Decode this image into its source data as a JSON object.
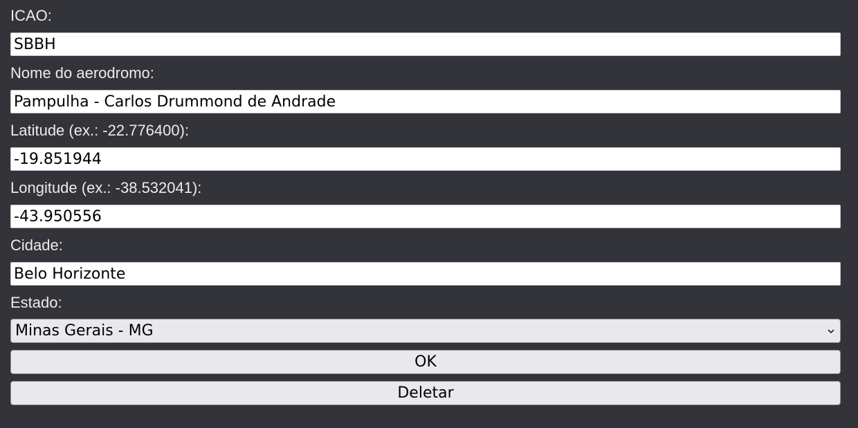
{
  "form": {
    "icao": {
      "label": "ICAO:",
      "value": "SBBH"
    },
    "nome": {
      "label": "Nome do aerodromo:",
      "value": "Pampulha - Carlos Drummond de Andrade"
    },
    "latitude": {
      "label": "Latitude (ex.: -22.776400):",
      "value": "-19.851944"
    },
    "longitude": {
      "label": "Longitude (ex.: -38.532041):",
      "value": "-43.950556"
    },
    "cidade": {
      "label": "Cidade:",
      "value": "Belo Horizonte"
    },
    "estado": {
      "label": "Estado:",
      "selected": "Minas Gerais - MG"
    },
    "ok_label": "OK",
    "deletar_label": "Deletar"
  },
  "colors": {
    "background": "#33333a",
    "label_text": "#ececec",
    "button_bg": "#e9e9ed"
  },
  "icons": {
    "select_chevron": "chevron-down-icon"
  }
}
